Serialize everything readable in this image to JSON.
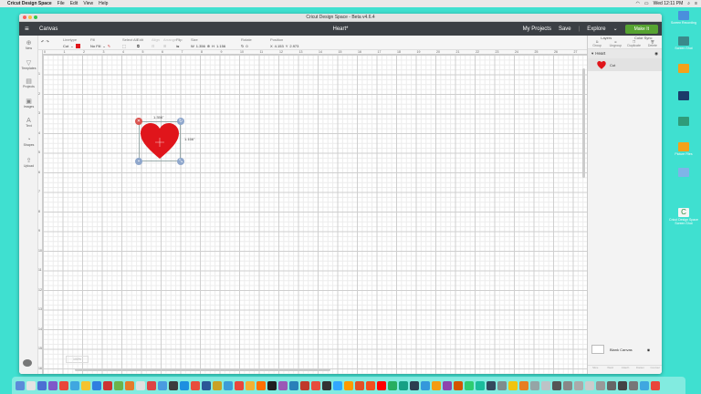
{
  "menubar": {
    "app_name": "Cricut Design Space",
    "items": [
      "File",
      "Edit",
      "View",
      "Help"
    ],
    "clock": "Wed 12:11 PM"
  },
  "window": {
    "title": "Cricut Design Space - Beta v4.6.4"
  },
  "header": {
    "canvas_label": "Canvas",
    "project_name": "Heart*",
    "my_projects": "My Projects",
    "save": "Save",
    "machine": "Explore",
    "make_it": "Make It"
  },
  "toolbar": {
    "linetype_label": "Linetype",
    "linetype_value": "Cut",
    "fill_label": "Fill",
    "fill_value": "No Fill",
    "select_all_label": "Select All",
    "edit_label": "Edit",
    "align_label": "Align",
    "arrange_label": "Arrange",
    "flip_label": "Flip",
    "size_label": "Size",
    "w_label": "W",
    "w_value": "1.356",
    "h_label": "H",
    "h_value": "1.156",
    "rotate_label": "Rotate",
    "rotate_value": "0",
    "position_label": "Position",
    "x_label": "X",
    "x_value": "4.153",
    "y_label": "Y",
    "y_value": "2.973",
    "accent_color": "#e0151b"
  },
  "leftbar": {
    "items": [
      "New",
      "Templates",
      "Projects",
      "Images",
      "Text",
      "Shapes",
      "Upload"
    ]
  },
  "canvas": {
    "top_ticks": [
      "0",
      "1",
      "2",
      "3",
      "4",
      "5",
      "6",
      "7",
      "8",
      "9",
      "10",
      "11",
      "12",
      "13",
      "14",
      "15",
      "16",
      "17",
      "18",
      "19",
      "20",
      "21",
      "22",
      "23",
      "24",
      "25",
      "26",
      "27"
    ],
    "left_ticks": [
      "1",
      "2",
      "3",
      "4",
      "5",
      "6",
      "7",
      "8",
      "9",
      "10",
      "11",
      "12",
      "13",
      "14",
      "15",
      "16"
    ],
    "width_dim": "1.356\"",
    "height_dim": "1.156\"",
    "zoom": "100%"
  },
  "rightpanel": {
    "tabs": [
      "Layers",
      "Color Sync"
    ],
    "tools": [
      "Group",
      "Ungroup",
      "Duplicate",
      "Delete"
    ],
    "layer_group": "Heart",
    "layer_item": "Cut",
    "blank_canvas": "Blank Canvas",
    "bottom_tools": [
      "Slice",
      "Weld",
      "Attach",
      "Flatten",
      "Contour"
    ]
  },
  "desktop": {
    "items": [
      "Screen Recording",
      "Screen Shot",
      "",
      "",
      "",
      "",
      "",
      "Picture Files",
      "Cricut Design Space Screen Shot"
    ]
  },
  "colors": {
    "teal_bg": "#3fe0d0",
    "header_bg": "#3b3f44",
    "make_green": "#56a331",
    "heart_red": "#e0151b",
    "handle_red": "#d9534f",
    "handle_blue": "#8fa7cc"
  }
}
